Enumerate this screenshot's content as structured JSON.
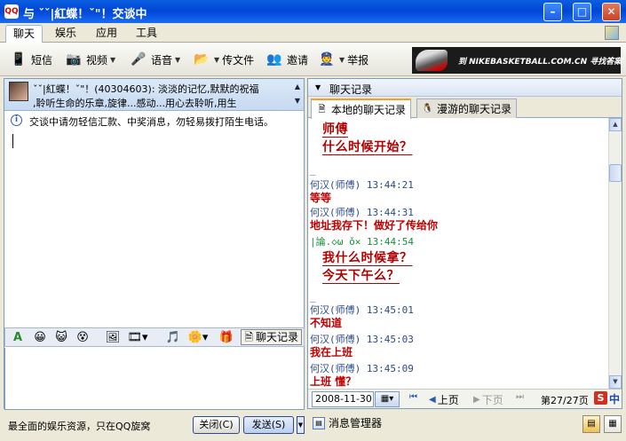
{
  "window": {
    "title": "与 ˇˇ|紅蝶！ˇ\"！交谈中",
    "minimize": "–",
    "maximize": "□",
    "close": "✕"
  },
  "menu": {
    "tabs": [
      "聊天",
      "娱乐",
      "应用",
      "工具"
    ]
  },
  "toolbar": {
    "sms": "短信",
    "video": "视频",
    "voice": "语音",
    "send_file": "传文件",
    "invite": "邀请",
    "report": "举报"
  },
  "ad": {
    "text": "到 NIKEBASKETBALL.COM.CN 寻找答案",
    "logo": "✓"
  },
  "contact": {
    "signature_line1": "ˇˇ|紅蝶！ˇ\"！(40304603): 淡淡的记忆,默默的祝福",
    "signature_line2": ",聆听生命的乐章,旋律...感动...用心去聆听,用生"
  },
  "notice": {
    "icon": "i",
    "text": "交谈中请勿轻信汇款、中奖消息，勿轻易拨打陌生电话。"
  },
  "input_toolbar": {
    "font_icon": "A",
    "chat_log_label": "聊天记录"
  },
  "bottom": {
    "status_text": "最全面的娱乐资源，只在QQ旋窝",
    "close_btn": "关闭(C)",
    "send_btn": "发送(S)"
  },
  "history": {
    "header": "聊天记录",
    "tab_local": "本地的聊天记录",
    "tab_roaming": "漫游的聊天记录",
    "messages": [
      {
        "type": "msg_big",
        "text": "师傅"
      },
      {
        "type": "msg_big",
        "text": "   什么时候开始？"
      },
      {
        "type": "sender",
        "text": "_"
      },
      {
        "type": "sender",
        "text": "何汉(师傅)  13:44:21"
      },
      {
        "type": "msg",
        "text": "  等等"
      },
      {
        "type": "sender",
        "text": "何汉(师傅)  13:44:31"
      },
      {
        "type": "msg",
        "text": "  地址我存下！做好了传给你"
      },
      {
        "type": "sender_alt",
        "text": "|論.◇ω ǒ✕  13:44:54"
      },
      {
        "type": "msg_big",
        "text": "我什么时候拿？"
      },
      {
        "type": "msg_big",
        "text": "   今天下午么？"
      },
      {
        "type": "sender",
        "text": "_"
      },
      {
        "type": "sender",
        "text": "何汉(师傅)  13:45:01"
      },
      {
        "type": "msg",
        "text": "  不知道"
      },
      {
        "type": "sender",
        "text": "何汉(师傅)  13:45:03"
      },
      {
        "type": "msg",
        "text": "  我在上班"
      },
      {
        "type": "sender",
        "text": "何汉(师傅)  13:45:09"
      },
      {
        "type": "msg",
        "text": "  上班  懂？"
      }
    ],
    "date": "2008-11-30",
    "prev_page": "上页",
    "next_page": "下页",
    "page_info": "第27/27页",
    "s_icon": "S",
    "zh_icon": "中"
  },
  "message_manager": "消息管理器"
}
